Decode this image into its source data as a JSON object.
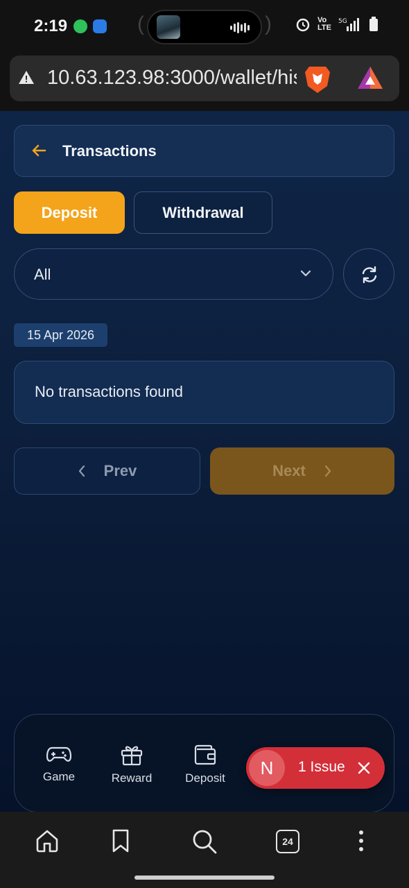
{
  "status_bar": {
    "time": "2:19",
    "network": "Vo LTE",
    "signal": "5G"
  },
  "browser": {
    "url": "10.63.123.98:3000/wallet/hist",
    "tab_count": "24"
  },
  "header": {
    "title": "Transactions"
  },
  "tabs": [
    {
      "label": "Deposit",
      "active": true
    },
    {
      "label": "Withdrawal",
      "active": false
    }
  ],
  "filter": {
    "selected": "All"
  },
  "date_badge": "15 Apr 2026",
  "empty_message": "No transactions found",
  "pagination": {
    "prev": "Prev",
    "next": "Next"
  },
  "bottom_nav": [
    {
      "label": "Game",
      "icon": "gamepad-icon"
    },
    {
      "label": "Reward",
      "icon": "gift-icon"
    },
    {
      "label": "Deposit",
      "icon": "wallet-icon"
    }
  ],
  "issue_toast": {
    "avatar": "N",
    "text": "1 Issue"
  },
  "colors": {
    "accent": "#f3a41b",
    "background": "#0c1f3c",
    "issue": "#d32f39"
  }
}
